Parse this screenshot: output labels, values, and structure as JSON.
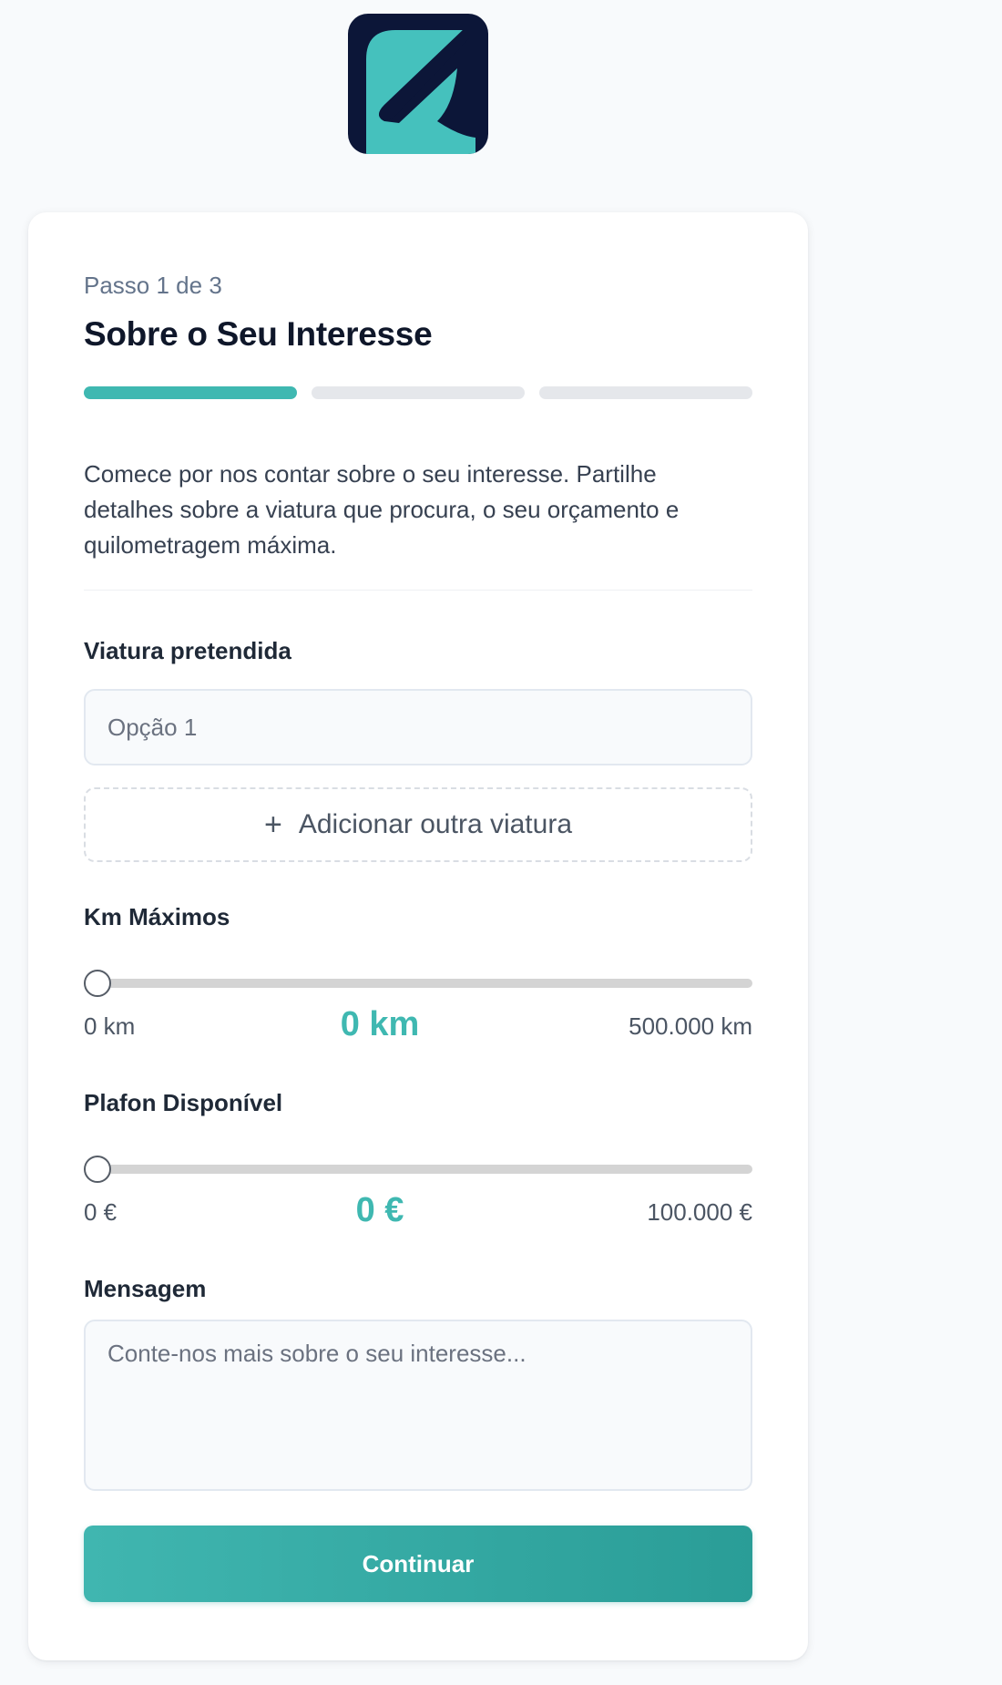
{
  "brand": {
    "logo_icon": "brand-logo-icon",
    "logo_bg_color": "#0c1638",
    "accent_color": "#3fb8b1"
  },
  "form": {
    "step_label": "Passo 1 de 3",
    "title": "Sobre o Seu Interesse",
    "progress": {
      "current_step": 1,
      "total_steps": 3
    },
    "intro": "Comece por nos contar sobre o seu interesse. Partilhe detalhes sobre a viatura que procura, o seu orçamento e quilometragem máxima.",
    "vehicle": {
      "label": "Viatura pretendida",
      "placeholder": "Opção 1",
      "value": ""
    },
    "add_vehicle": {
      "icon": "plus-icon",
      "label": "Adicionar outra viatura"
    },
    "km": {
      "label": "Km Máximos",
      "min_label": "0 km",
      "max_label": "500.000 km",
      "current_label": "0 km",
      "value": 0,
      "min": 0,
      "max": 500000
    },
    "budget": {
      "label": "Plafon Disponível",
      "min_label": "0 €",
      "max_label": "100.000 €",
      "current_label": "0 €",
      "value": 0,
      "min": 0,
      "max": 100000
    },
    "message": {
      "label": "Mensagem",
      "placeholder": "Conte-nos mais sobre o seu interesse...",
      "value": ""
    },
    "submit_label": "Continuar"
  }
}
